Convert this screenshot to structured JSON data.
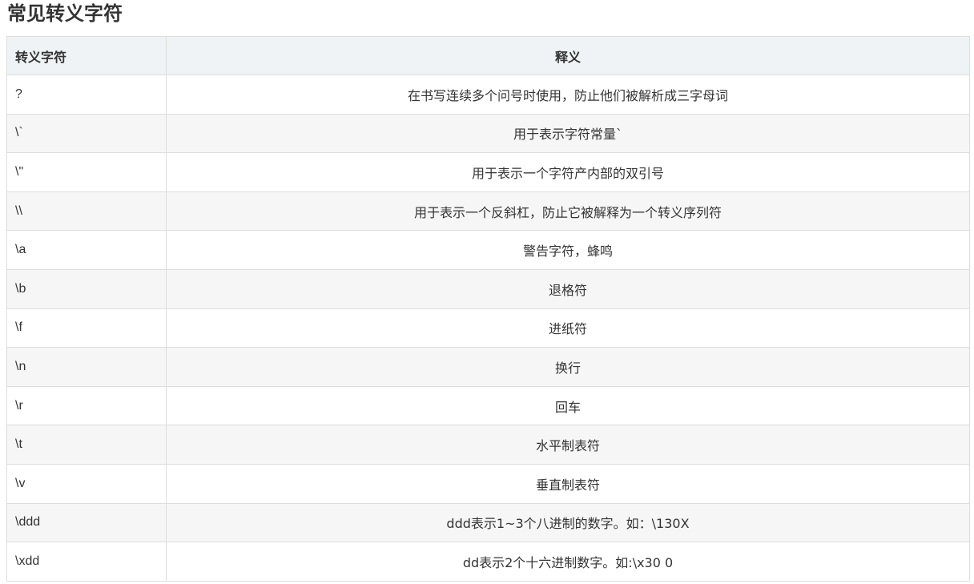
{
  "title": "常见转义字符",
  "table": {
    "headers": [
      "转义字符",
      "释义"
    ],
    "rows": [
      {
        "char": "?",
        "meaning": "在书写连续多个问号时使用，防止他们被解析成三字母词"
      },
      {
        "char": "\\`",
        "meaning": "用于表示字符常量`"
      },
      {
        "char": "\\\"",
        "meaning": "用于表示一个字符产内部的双引号"
      },
      {
        "char": "\\\\",
        "meaning": "用于表示一个反斜杠，防止它被解释为一个转义序列符"
      },
      {
        "char": "\\a",
        "meaning": "警告字符，蜂鸣"
      },
      {
        "char": "\\b",
        "meaning": "退格符"
      },
      {
        "char": "\\f",
        "meaning": "进纸符"
      },
      {
        "char": "\\n",
        "meaning": "换行"
      },
      {
        "char": "\\r",
        "meaning": "回车"
      },
      {
        "char": "\\t",
        "meaning": "水平制表符"
      },
      {
        "char": "\\v",
        "meaning": "垂直制表符"
      },
      {
        "char": "\\ddd",
        "meaning": "ddd表示1~3个八进制的数字。如：\\130X"
      },
      {
        "char": "\\xdd",
        "meaning": "dd表示2个十六进制数字。如:\\x30 0"
      }
    ]
  }
}
